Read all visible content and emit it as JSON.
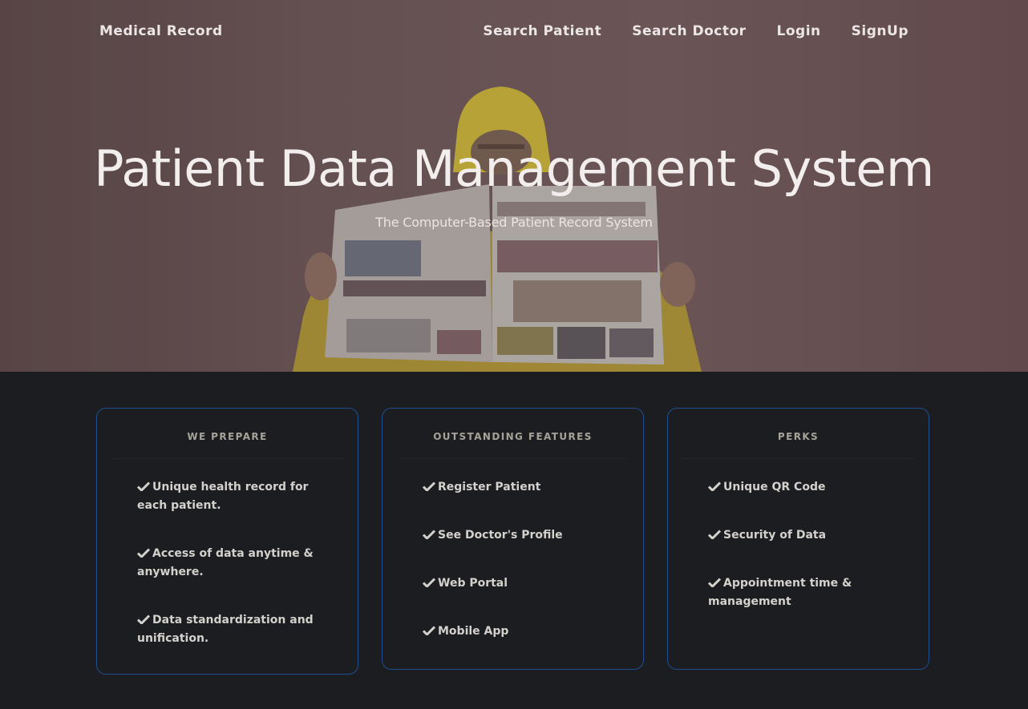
{
  "navbar": {
    "brand": "Medical Record",
    "links": [
      "Search Patient",
      "Search Doctor",
      "Login",
      "SignUp"
    ]
  },
  "hero": {
    "title": "Patient Data Management System",
    "subtitle": "The Computer-Based Patient Record System",
    "image_description_icon": "person-reading-newspaper-photo"
  },
  "cards": [
    {
      "title": "WE PREPARE",
      "items": [
        "Unique health record for each patient.",
        "Access of data anytime & anywhere.",
        "Data standardization and unification."
      ]
    },
    {
      "title": "OUTSTANDING FEATURES",
      "items": [
        "Register Patient",
        "See Doctor's Profile",
        "Web Portal",
        "Mobile App"
      ]
    },
    {
      "title": "PERKS",
      "items": [
        "Unique QR Code",
        "Security of Data",
        "Appointment time & management"
      ]
    }
  ],
  "colors": {
    "background": "#1b1d21",
    "card_border": "#1d4f8e",
    "hero_tint": "#6e585a",
    "text_light": "#ece6e6",
    "card_title": "#a7a399"
  },
  "icons": {
    "list_bullet": "check-icon"
  }
}
